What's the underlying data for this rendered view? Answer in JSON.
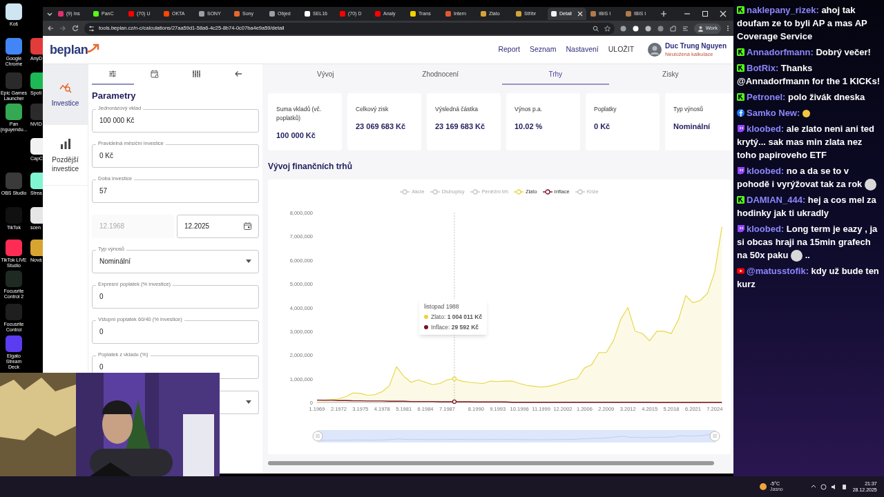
{
  "desktop": {
    "icons": [
      {
        "label": "Koš",
        "color": "#cfe6f2"
      },
      {
        "label": "Google Chrome",
        "color": "#4285f4"
      },
      {
        "label": "Epic Games Launcher",
        "color": "#2a2a2a"
      },
      {
        "label": "Pan (nguyendu...",
        "color": "#34a853"
      },
      {
        "label": "OBS Studio",
        "color": "#3a3a3a"
      },
      {
        "label": "TikTok",
        "color": "#111111"
      },
      {
        "label": "TikTok LIVE Studio",
        "color": "#fe2c55"
      },
      {
        "label": "Focusrite Control 2",
        "color": "#1e2a22"
      },
      {
        "label": "Focusrite Control",
        "color": "#1f1f1f"
      },
      {
        "label": "Elgato Stream Deck",
        "color": "#5b3cf0"
      }
    ],
    "icons_behind": [
      {
        "label": "AnyD",
        "color": "#e23b3b"
      },
      {
        "label": "Spoti",
        "color": "#1db954"
      },
      {
        "label": "NVID",
        "color": "#2b2b2b"
      },
      {
        "label": "CapC",
        "color": "#f2f2f2"
      },
      {
        "label": "Strea",
        "color": "#80f5d2"
      },
      {
        "label": "scen",
        "color": "#e6e6e6"
      },
      {
        "label": "Nová",
        "color": "#d8a431"
      }
    ]
  },
  "browser": {
    "tabs": [
      {
        "title": "(9) Ins",
        "color": "#e1306c",
        "selected": false
      },
      {
        "title": "PanC",
        "color": "#53fc18",
        "selected": false
      },
      {
        "title": "(70) U",
        "color": "#ff0000",
        "selected": false
      },
      {
        "title": "OKTA",
        "color": "#ff4500",
        "selected": false
      },
      {
        "title": "SONY",
        "color": "#9aa0a6",
        "selected": false
      },
      {
        "title": "Sony",
        "color": "#e8672e",
        "selected": false
      },
      {
        "title": "Objed",
        "color": "#9aa0a6",
        "selected": false
      },
      {
        "title": "SEL16",
        "color": "#ffffff",
        "selected": false
      },
      {
        "title": "(70) D",
        "color": "#ff0000",
        "selected": false
      },
      {
        "title": "Analy",
        "color": "#ff0000",
        "selected": false
      },
      {
        "title": "Trans",
        "color": "#f5d000",
        "selected": false
      },
      {
        "title": "Intern",
        "color": "#e4572e",
        "selected": false
      },
      {
        "title": "Zlato",
        "color": "#d4a536",
        "selected": false
      },
      {
        "title": "Stříbr",
        "color": "#d4a536",
        "selected": false
      },
      {
        "title": "Detail",
        "color": "#f1f3f4",
        "selected": true
      },
      {
        "title": "IBIS I",
        "color": "#b07a4a",
        "selected": false
      },
      {
        "title": "IBIS I",
        "color": "#b07a4a",
        "selected": false
      }
    ],
    "url": "tools.beplan.cz/n-c/calculations/27aa59d1-58a6-4c25-8b74-0c07ba4e9a59/detail",
    "profile": "Work"
  },
  "app": {
    "logo": "beplan",
    "nav": [
      {
        "label": "Report",
        "kind": "link"
      },
      {
        "label": "Seznam",
        "kind": "link"
      },
      {
        "label": "Nastavení",
        "kind": "link"
      },
      {
        "label": "ULOŽIT",
        "kind": "action"
      }
    ],
    "user": {
      "name": "Duc Trung Nguyen",
      "status": "Neuložená kalkulace"
    },
    "sidebar": [
      {
        "label": "Investice",
        "selected": true
      },
      {
        "label": "Pozdější investice",
        "selected": false
      }
    ],
    "panel_tabs": [
      {
        "selected": true
      },
      {
        "selected": false
      },
      {
        "selected": false
      },
      {
        "selected": false
      }
    ],
    "panel_title": "Parametry",
    "fields": [
      {
        "kind": "text",
        "label": "Jednorázový vklad",
        "value": "100 000 Kč"
      },
      {
        "kind": "text",
        "label": "Pravidelná měsíční investice",
        "value": "0 Kč"
      },
      {
        "kind": "text",
        "label": "Doba investice",
        "value": "57"
      },
      {
        "kind": "date_pair",
        "from": {
          "value": "12.1968",
          "disabled": true
        },
        "to": {
          "value": "12.2025",
          "disabled": false
        }
      },
      {
        "kind": "select",
        "label": "Typ výnosů",
        "value": "Nominální"
      },
      {
        "kind": "text",
        "label": "Expresní poplatek (% investice)",
        "value": "0"
      },
      {
        "kind": "text",
        "label": "Vstupní poplatek 60/40 (% investice)",
        "value": "0"
      },
      {
        "kind": "text",
        "label": "Poplatek z vkladu (%)",
        "value": "0"
      },
      {
        "kind": "select"
      }
    ],
    "tabs": [
      {
        "label": "Vývoj",
        "selected": false
      },
      {
        "label": "Zhodnocení",
        "selected": false
      },
      {
        "label": "Trhy",
        "selected": true
      },
      {
        "label": "Zisky",
        "selected": false
      }
    ],
    "stats": [
      {
        "label": "Suma vkladů (vč. poplatků)",
        "value": "100 000 Kč"
      },
      {
        "label": "Celkový zisk",
        "value": "23 069 683 Kč"
      },
      {
        "label": "Výsledná částka",
        "value": "23 169 683 Kč"
      },
      {
        "label": "Výnos p.a.",
        "value": "10.02 %"
      },
      {
        "label": "Poplatky",
        "value": "0 Kč"
      },
      {
        "label": "Typ výnosů",
        "value": "Nominální"
      }
    ],
    "section_title": "Vývoj finančních trhů",
    "chart": {
      "legend": [
        {
          "name": "Akcie",
          "enabled": false
        },
        {
          "name": "Dluhopisy",
          "enabled": false
        },
        {
          "name": "Peněžní trh",
          "enabled": false
        },
        {
          "enabled": true
        },
        {
          "enabled": true
        },
        {
          "name": "Krize",
          "enabled": false
        }
      ],
      "chart_data": {
        "type": "area",
        "categories": [
          "1.1969",
          null,
          null,
          "2.1972",
          null,
          null,
          "3.1975",
          null,
          null,
          "4.1978",
          null,
          null,
          "5.1981",
          null,
          null,
          "6.1984",
          null,
          null,
          "7.1987",
          null,
          null,
          null,
          "8.1990",
          null,
          null,
          "9.1993",
          null,
          null,
          "10.1996",
          null,
          null,
          "11.1999",
          null,
          null,
          "12.2002",
          null,
          null,
          "1.2006",
          null,
          null,
          "2.2009",
          null,
          null,
          "3.2012",
          null,
          null,
          "4.2015",
          null,
          null,
          "5.2018",
          null,
          null,
          "6.2021",
          null,
          null,
          "7.2024",
          null
        ],
        "series": [
          {
            "name": "Zlato",
            "color": "#e6d53c",
            "values": [
              100000,
              100000,
              120000,
              150000,
              250000,
              400000,
              380000,
              300000,
              330000,
              450000,
              700000,
              1500000,
              1100000,
              850000,
              950000,
              850000,
              750000,
              800000,
              950000,
              1000000,
              900000,
              850000,
              820000,
              800000,
              900000,
              880000,
              900000,
              900000,
              800000,
              720000,
              680000,
              650000,
              680000,
              750000,
              850000,
              950000,
              1000000,
              1450000,
              1600000,
              2100000,
              2100000,
              2600000,
              3500000,
              4000000,
              3000000,
              2900000,
              2600000,
              3000000,
              3000000,
              2900000,
              3500000,
              4500000,
              4200000,
              4300000,
              4600000,
              5500000,
              7400000
            ]
          },
          {
            "name": "Inflace",
            "color": "#7a1126",
            "type": "line",
            "values": [
              100000,
              90000,
              90000,
              80000,
              80000,
              70000,
              70000,
              60000,
              60000,
              60000,
              50000,
              50000,
              50000,
              40000,
              40000,
              40000,
              40000,
              30000,
              30000,
              30000,
              30000,
              30000,
              20000,
              20000,
              20000,
              20000,
              20000,
              10000,
              10000,
              10000,
              10000,
              10000,
              10000,
              10000,
              10000,
              10000,
              10000,
              10000,
              10000,
              10000,
              10000,
              10000,
              10000,
              10000,
              10000,
              10000,
              10000,
              0,
              0,
              0,
              0,
              0,
              0,
              0,
              0,
              0,
              0
            ]
          }
        ],
        "ylim": [
          0,
          8000000
        ],
        "yticks": [
          {
            "value": 0,
            "label": "0"
          },
          {
            "value": 1000000,
            "label": "1,000,000"
          },
          {
            "value": 2000000,
            "label": "2,000,000"
          },
          {
            "value": 3000000,
            "label": "3,000,000"
          },
          {
            "value": 4000000,
            "label": "4,000,000"
          },
          {
            "value": 5000000,
            "label": "5,000,000"
          },
          {
            "value": 6000000,
            "label": "6,000,000"
          },
          {
            "value": 7000000,
            "label": "7,000,000"
          },
          {
            "value": 8000000,
            "label": "8,000,000"
          }
        ]
      },
      "tooltip": {
        "title": "listopad 1988",
        "items": [
          {
            "text": "Zlato: **1 004 011 Kč**",
            "color": "#e6d53c"
          },
          {
            "text": "Inflace: **29 592 Kč**",
            "color": "#7a1126"
          }
        ]
      }
    }
  },
  "chat": [
    {
      "kind": "kick",
      "user": "naklepany_rizek:",
      "text": "ahoj tak doufam ze to byli AP a mas AP Coverage Service"
    },
    {
      "kind": "kick",
      "user": "Annadorfmann:",
      "text": "Dobrý večer!"
    },
    {
      "kind": "kick",
      "user": "BotRix:",
      "text": "Thanks @Annadorfmann for the 1 KICKs!"
    },
    {
      "kind": "kick",
      "user": "Petronel:",
      "text": "polo živák dneska"
    },
    {
      "kind": "facebook",
      "user": "Samko New:",
      "emote": {
        "kind": "smiley"
      }
    },
    {
      "kind": "twitch",
      "user": "kloobed:",
      "text": "ale zlato neni ani ted krytý... sak mas min zlata nez toho papiroveho ETF"
    },
    {
      "kind": "twitch",
      "user": "kloobed:",
      "text": "no a da se to v pohodě i vyrýžovat tak za rok",
      "emote": {
        "kind": "grin"
      }
    },
    {
      "kind": "kick",
      "user": "DAMIAN_444:",
      "text": "hej a cos mel za hodinky jak ti ukradly"
    },
    {
      "kind": "twitch",
      "user": "kloobed:",
      "text": "Long term je eazy , ja si obcas hraji na 15min grafech na 50x paku",
      "emote": {
        "kind": "grin"
      },
      "text_after": ".."
    },
    {
      "kind": "youtube",
      "user": "@matusstofik:",
      "text": "kdy už bude ten kurz"
    }
  ],
  "taskbar": {
    "weather": {
      "temp": "-5°C",
      "condition": "Jasno"
    },
    "time": "21:37",
    "date": "28.12.2025"
  }
}
